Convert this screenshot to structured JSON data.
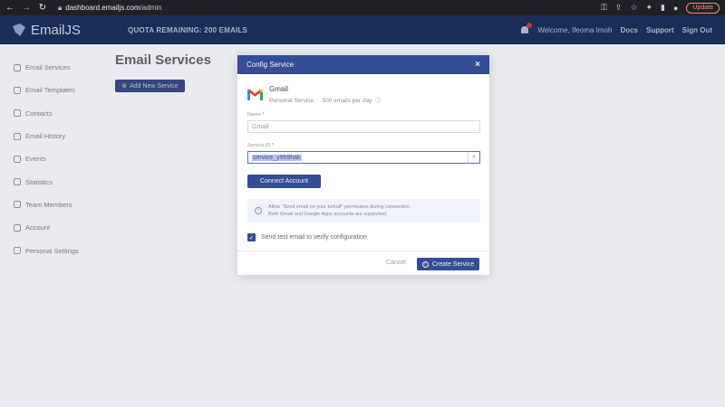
{
  "browser": {
    "url_host": "dashboard.emailjs.com",
    "url_path": "/admin",
    "update_label": "Update"
  },
  "header": {
    "logo_text": "EmailJS",
    "quota": "QUOTA REMAINING: 200 EMAILS",
    "welcome": "Welcome, Ifeoma Imoh",
    "links": [
      "Docs",
      "Support",
      "Sign Out"
    ]
  },
  "sidebar": {
    "items": [
      {
        "label": "Email Services",
        "icon": "link-icon"
      },
      {
        "label": "Email Templates",
        "icon": "template-icon"
      },
      {
        "label": "Contacts",
        "icon": "contacts-icon"
      },
      {
        "label": "Email History",
        "icon": "history-icon"
      },
      {
        "label": "Events",
        "icon": "events-icon"
      },
      {
        "label": "Statistics",
        "icon": "statistics-icon"
      },
      {
        "label": "Team Members",
        "icon": "team-icon"
      },
      {
        "label": "Account",
        "icon": "account-icon"
      },
      {
        "label": "Personal Settings",
        "icon": "settings-icon"
      }
    ]
  },
  "main": {
    "title": "Email Services",
    "add_button": "Add New Service"
  },
  "modal": {
    "title": "Config Service",
    "close": "×",
    "service_name": "Gmail",
    "service_type": "Personal Service",
    "service_limit": "500 emails per day",
    "name_label": "Name",
    "name_value": "Gmail",
    "service_id_label": "Service ID",
    "service_id_value": "service_y9h9hak",
    "connect_button": "Connect Account",
    "info_line1": "Allow \"Send email on your behalf\" permission during connection.",
    "info_line2": "Both Gmail and Google Apps accounts are supported.",
    "checkbox_label": "Send test email to verify configuration",
    "checkbox_checked": true,
    "cancel_button": "Cancel",
    "create_button": "Create Service"
  },
  "colors": {
    "header_bg": "#1b2e58",
    "primary": "#354d94",
    "overlay_bg": "#e9eaee"
  }
}
